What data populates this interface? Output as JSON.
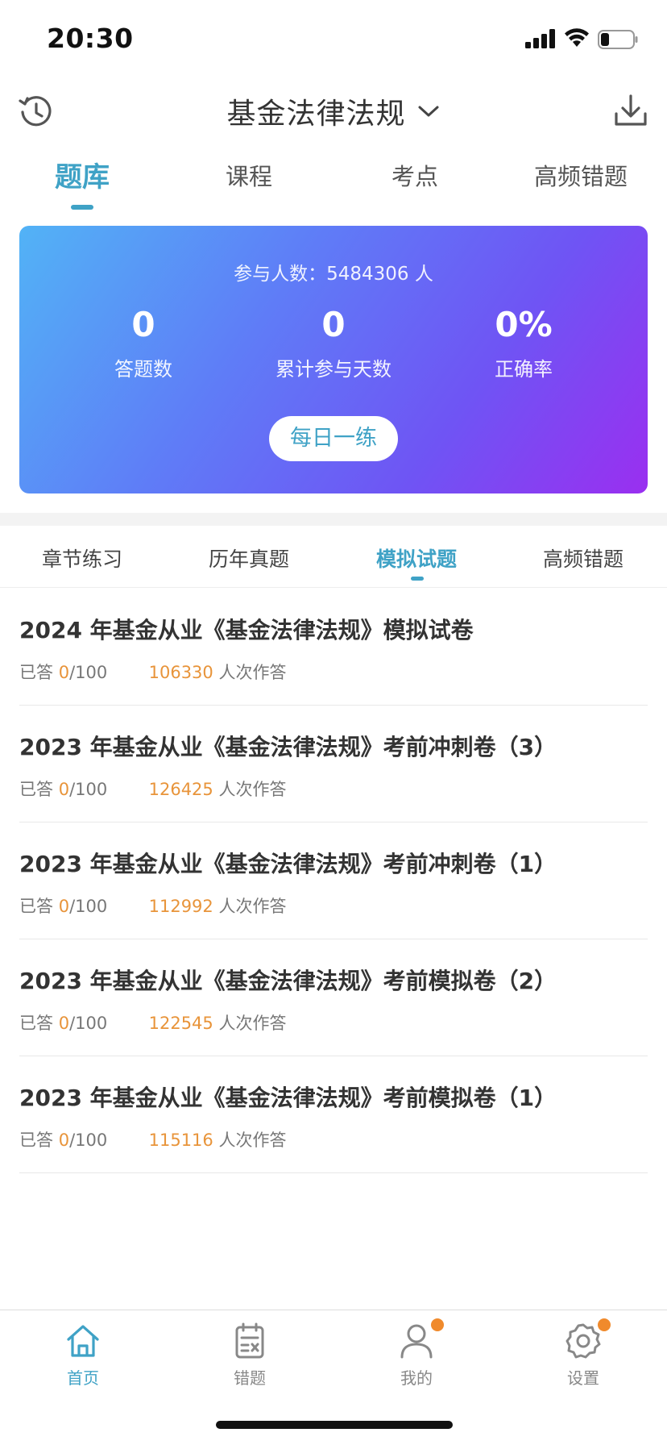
{
  "status_bar": {
    "time": "20:30"
  },
  "header": {
    "title": "基金法律法规"
  },
  "top_tabs": [
    {
      "label": "题库",
      "active": true
    },
    {
      "label": "课程",
      "active": false
    },
    {
      "label": "考点",
      "active": false
    },
    {
      "label": "高频错题",
      "active": false
    }
  ],
  "stats": {
    "participants": "参与人数：5484306 人",
    "items": [
      {
        "value": "0",
        "label": "答题数"
      },
      {
        "value": "0",
        "label": "累计参与天数"
      },
      {
        "value": "0%",
        "label": "正确率"
      }
    ],
    "daily_button": "每日一练"
  },
  "sub_tabs": [
    {
      "label": "章节练习",
      "active": false
    },
    {
      "label": "历年真题",
      "active": false
    },
    {
      "label": "模拟试题",
      "active": true
    },
    {
      "label": "高频错题",
      "active": false
    }
  ],
  "exams": [
    {
      "title": "2024 年基金从业《基金法律法规》模拟试卷",
      "answered_prefix": "已答",
      "answered": "0",
      "total": "/100",
      "attempts": "106330",
      "attempts_suffix": "人次作答"
    },
    {
      "title": "2023 年基金从业《基金法律法规》考前冲刺卷（3）",
      "answered_prefix": "已答",
      "answered": "0",
      "total": "/100",
      "attempts": "126425",
      "attempts_suffix": "人次作答"
    },
    {
      "title": "2023 年基金从业《基金法律法规》考前冲刺卷（1）",
      "answered_prefix": "已答",
      "answered": "0",
      "total": "/100",
      "attempts": "112992",
      "attempts_suffix": "人次作答"
    },
    {
      "title": "2023 年基金从业《基金法律法规》考前模拟卷（2）",
      "answered_prefix": "已答",
      "answered": "0",
      "total": "/100",
      "attempts": "122545",
      "attempts_suffix": "人次作答"
    },
    {
      "title": "2023 年基金从业《基金法律法规》考前模拟卷（1）",
      "answered_prefix": "已答",
      "answered": "0",
      "total": "/100",
      "attempts": "115116",
      "attempts_suffix": "人次作答"
    }
  ],
  "bottom_nav": [
    {
      "label": "首页",
      "icon": "home-icon",
      "active": true,
      "badge": false
    },
    {
      "label": "错题",
      "icon": "mistakes-icon",
      "active": false,
      "badge": false
    },
    {
      "label": "我的",
      "icon": "profile-icon",
      "active": false,
      "badge": true
    },
    {
      "label": "设置",
      "icon": "settings-icon",
      "active": false,
      "badge": true
    }
  ],
  "colors": {
    "accent": "#3fa2c6",
    "orange": "#e8943a",
    "badge": "#f08a2c",
    "gradient_start": "#52b3f6",
    "gradient_end": "#9a2ff0"
  }
}
